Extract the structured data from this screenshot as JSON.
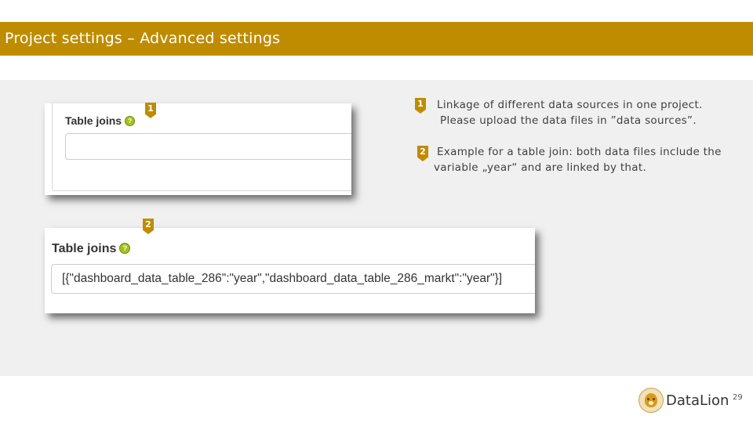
{
  "slide": {
    "title": "Project settings – Advanced settings",
    "page_number": "29",
    "brand": "DataLion"
  },
  "screenshot_1": {
    "label": "Table joins",
    "help_icon": "question-icon",
    "input_value": ""
  },
  "screenshot_2": {
    "label": "Table joins",
    "help_icon": "question-icon",
    "input_value": "[{\"dashboard_data_table_286\":\"year\",\"dashboard_data_table_286_markt\":\"year\"}]"
  },
  "markers": [
    "1",
    "2"
  ],
  "explanations": {
    "item_1_line_1": "Linkage of different data sources in one project.",
    "item_1_line_2": "Please upload the data files in ”data sources”.",
    "item_2_line_1": "Example for a table join: both data files include the",
    "item_2_line_2": "variable „year“ and are linked by that."
  },
  "colors": {
    "accent": "#bf8c00",
    "content_background": "#f0f0f0",
    "help_icon": "#a3c41a"
  }
}
